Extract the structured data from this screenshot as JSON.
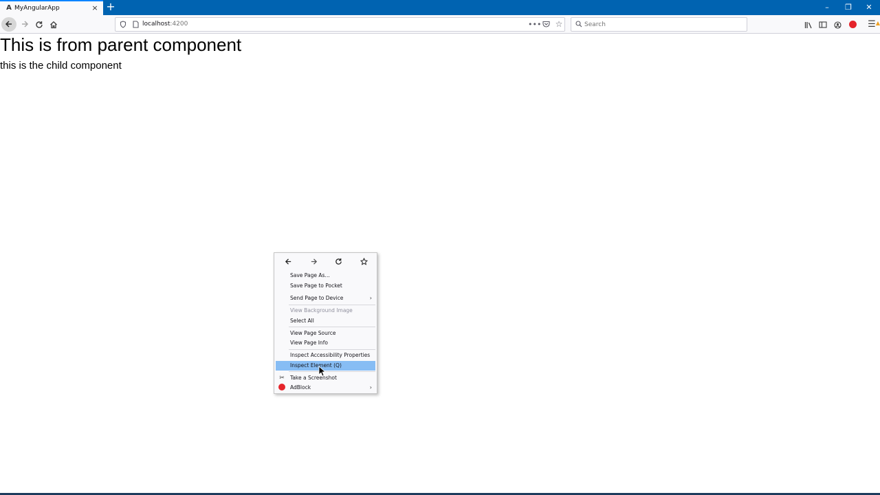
{
  "tab": {
    "title": "MyAngularApp",
    "favicon": "A",
    "close": "×"
  },
  "new_tab": "+",
  "window_controls": {
    "minimize": "–",
    "restore": "❐",
    "close": "✕"
  },
  "url": {
    "host": "localhost",
    "port": ":4200"
  },
  "search": {
    "placeholder": "Search"
  },
  "page": {
    "heading": "This is from parent component",
    "child": "this is the child component"
  },
  "context_menu": {
    "items": [
      {
        "label": "Save Page As…",
        "disabled": false
      },
      {
        "label": "Save Page to Pocket",
        "disabled": false
      },
      {
        "label": "Send Page to Device",
        "disabled": false,
        "submenu": true
      },
      {
        "label": "View Background Image",
        "disabled": true
      },
      {
        "label": "Select All",
        "disabled": false
      },
      {
        "label": "View Page Source",
        "disabled": false
      },
      {
        "label": "View Page Info",
        "disabled": false
      },
      {
        "label": "Inspect Accessibility Properties",
        "disabled": false
      },
      {
        "label": "Inspect Element (Q)",
        "disabled": false,
        "highlighted": true
      },
      {
        "label": "Take a Screenshot",
        "disabled": false,
        "icon": "scissors-icon"
      },
      {
        "label": "AdBlock",
        "disabled": false,
        "submenu": true,
        "icon": "adblock-icon"
      }
    ],
    "submenu_arrow": "›"
  },
  "colors": {
    "tabstrip": "#0063b1",
    "toolbar": "#f9f9fb",
    "highlight": "#87bdf4",
    "adblock_red": "#e5242b"
  }
}
